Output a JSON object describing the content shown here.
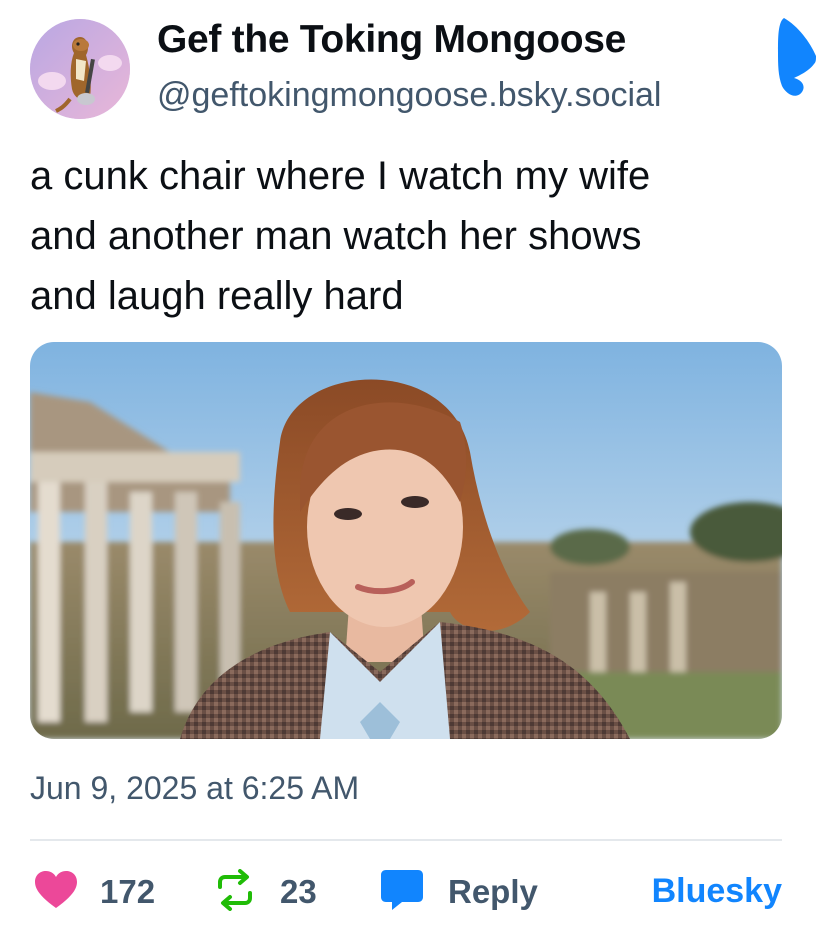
{
  "author": {
    "display_name": "Gef the Toking Mongoose",
    "handle": "@geftokingmongoose.bsky.social",
    "avatar_icon": "mongoose-avatar"
  },
  "post": {
    "text": "a cunk chair where I watch my wife\nand another man watch her shows\nand laugh really hard",
    "timestamp": "Jun 9, 2025 at 6:25 AM"
  },
  "stats": {
    "likes": "172",
    "reposts": "23",
    "reply_label": "Reply"
  },
  "footer": {
    "brand_link": "Bluesky"
  },
  "colors": {
    "brand_blue": "#1185fe",
    "like_pink": "#ec4899",
    "repost_green": "#20bc07",
    "muted_text": "#42576c",
    "divider": "#e4e8ec"
  },
  "icons": [
    "bluesky-butterfly-icon",
    "heart-icon",
    "repost-icon",
    "reply-bubble-icon"
  ]
}
